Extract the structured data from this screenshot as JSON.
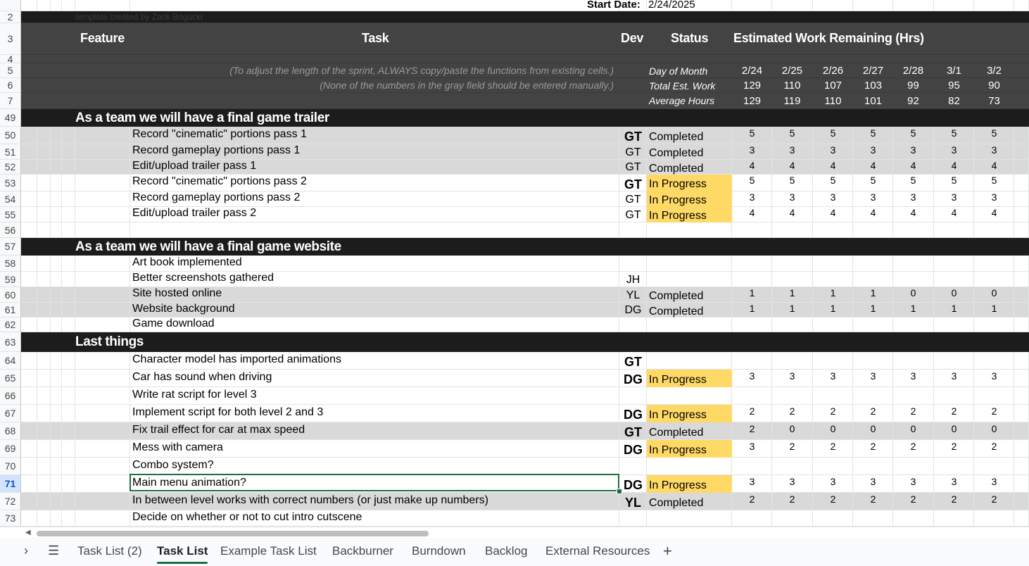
{
  "app": {
    "sheet_tabs_active": "Task List"
  },
  "header": {
    "start_label": "Start Date:",
    "start_value": "2/24/2025",
    "credit": "template created by Zack Bogucki",
    "col_feature": "Feature",
    "col_task": "Task",
    "col_dev": "Dev",
    "col_status": "Status",
    "col_estimate": "Estimated Work Remaining (Hrs)",
    "note1": "(To adjust the length of the sprint, ALWAYS copy/paste the functions from existing cells.)",
    "note2": "(None of the numbers in the gray field should be entered manually.)",
    "lbl_day": "Day of Month",
    "lbl_total": "Total Est. Work",
    "lbl_avg": "Average Hours",
    "dates": [
      "2/24",
      "2/25",
      "2/26",
      "2/27",
      "2/28",
      "3/1",
      "3/2"
    ],
    "totals": [
      "129",
      "110",
      "107",
      "103",
      "99",
      "95",
      "90"
    ],
    "averages": [
      "129",
      "119",
      "110",
      "101",
      "92",
      "82",
      "73"
    ]
  },
  "rows": [
    {
      "n": "49",
      "type": "section",
      "title": "As a team we will have a final game trailer"
    },
    {
      "n": "50",
      "type": "task",
      "bg": "gray",
      "task": "Record \"cinematic\" portions pass 1",
      "dev": "GT",
      "devBold": true,
      "status": "Completed",
      "vals": [
        "5",
        "5",
        "5",
        "5",
        "5",
        "5",
        "5"
      ]
    },
    {
      "n": "51",
      "type": "task",
      "bg": "gray",
      "task": "Record gameplay portions pass 1",
      "dev": "GT",
      "devBold": false,
      "status": "Completed",
      "vals": [
        "3",
        "3",
        "3",
        "3",
        "3",
        "3",
        "3"
      ]
    },
    {
      "n": "52",
      "type": "task",
      "bg": "gray",
      "task": "Edit/upload trailer pass 1",
      "dev": "GT",
      "devBold": false,
      "status": "Completed",
      "vals": [
        "4",
        "4",
        "4",
        "4",
        "4",
        "4",
        "4"
      ]
    },
    {
      "n": "53",
      "type": "task",
      "bg": "white",
      "task": "Record \"cinematic\" portions pass 2",
      "dev": "GT",
      "devBold": true,
      "status": "In Progress",
      "vals": [
        "5",
        "5",
        "5",
        "5",
        "5",
        "5",
        "5"
      ]
    },
    {
      "n": "54",
      "type": "task",
      "bg": "white",
      "task": "Record gameplay portions pass 2",
      "dev": "GT",
      "devBold": false,
      "status": "In Progress",
      "vals": [
        "3",
        "3",
        "3",
        "3",
        "3",
        "3",
        "3"
      ]
    },
    {
      "n": "55",
      "type": "task",
      "bg": "white",
      "task": "Edit/upload trailer pass 2",
      "dev": "GT",
      "devBold": false,
      "status": "In Progress",
      "vals": [
        "4",
        "4",
        "4",
        "4",
        "4",
        "4",
        "4"
      ]
    },
    {
      "n": "56",
      "type": "blank"
    },
    {
      "n": "57",
      "type": "section",
      "title": "As a team we will have a final game website"
    },
    {
      "n": "58",
      "type": "task",
      "bg": "white",
      "task": "Art book implemented",
      "dev": "",
      "devBold": false,
      "status": "",
      "vals": []
    },
    {
      "n": "59",
      "type": "task",
      "bg": "white",
      "task": "Better screenshots gathered",
      "dev": "JH",
      "devBold": false,
      "status": "",
      "vals": []
    },
    {
      "n": "60",
      "type": "task",
      "bg": "gray",
      "task": "Site hosted online",
      "dev": "YL",
      "devBold": false,
      "status": "Completed",
      "vals": [
        "1",
        "1",
        "1",
        "1",
        "0",
        "0",
        "0"
      ]
    },
    {
      "n": "61",
      "type": "task",
      "bg": "gray",
      "task": "Website background",
      "dev": "DG",
      "devBold": false,
      "status": "Completed",
      "vals": [
        "1",
        "1",
        "1",
        "1",
        "1",
        "1",
        "1"
      ]
    },
    {
      "n": "62",
      "type": "task",
      "bg": "white",
      "task": "Game download",
      "dev": "",
      "devBold": false,
      "status": "",
      "vals": []
    },
    {
      "n": "63",
      "type": "section",
      "title": "Last things"
    },
    {
      "n": "64",
      "type": "task",
      "bg": "white",
      "task": "Character model has imported animations",
      "dev": "GT",
      "devBold": true,
      "status": "",
      "vals": []
    },
    {
      "n": "65",
      "type": "task",
      "bg": "white",
      "task": "Car has sound when driving",
      "dev": "DG",
      "devBold": true,
      "status": "In Progress",
      "vals": [
        "3",
        "3",
        "3",
        "3",
        "3",
        "3",
        "3"
      ]
    },
    {
      "n": "66",
      "type": "task",
      "bg": "white",
      "task": "Write rat script for level 3",
      "dev": "",
      "devBold": false,
      "status": "",
      "vals": []
    },
    {
      "n": "67",
      "type": "task",
      "bg": "white",
      "task": "Implement script for both level 2 and 3",
      "dev": "DG",
      "devBold": true,
      "status": "In Progress",
      "vals": [
        "2",
        "2",
        "2",
        "2",
        "2",
        "2",
        "2"
      ]
    },
    {
      "n": "68",
      "type": "task",
      "bg": "gray",
      "task": "Fix trail effect for car at max speed",
      "dev": "GT",
      "devBold": true,
      "status": "Completed",
      "vals": [
        "2",
        "0",
        "0",
        "0",
        "0",
        "0",
        "0"
      ]
    },
    {
      "n": "69",
      "type": "task",
      "bg": "white",
      "task": "Mess with camera",
      "dev": "DG",
      "devBold": true,
      "status": "In Progress",
      "vals": [
        "3",
        "2",
        "2",
        "2",
        "2",
        "2",
        "2"
      ]
    },
    {
      "n": "70",
      "type": "task",
      "bg": "white",
      "task": "Combo system?",
      "dev": "",
      "devBold": false,
      "status": "",
      "vals": []
    },
    {
      "n": "71",
      "type": "task",
      "bg": "white",
      "task": "Main menu animation?",
      "dev": "DG",
      "devBold": true,
      "status": "In Progress",
      "vals": [
        "3",
        "3",
        "3",
        "3",
        "3",
        "3",
        "3"
      ],
      "selected": true
    },
    {
      "n": "72",
      "type": "task",
      "bg": "gray",
      "task": "In between level works with correct numbers (or just make up numbers)",
      "dev": "YL",
      "devBold": true,
      "status": "Completed",
      "vals": [
        "2",
        "2",
        "2",
        "2",
        "2",
        "2",
        "2"
      ]
    },
    {
      "n": "73",
      "type": "task",
      "bg": "white",
      "task": "Decide on whether or not to cut intro cutscene",
      "dev": "",
      "devBold": false,
      "status": "",
      "vals": []
    }
  ],
  "tabs": [
    "Task List (2)",
    "Task List",
    "Example Task List",
    "Backburner",
    "Burndown",
    "Backlog",
    "External Resources"
  ],
  "colors": {
    "section_bg": "#1c1c1c",
    "header_bg": "#434343",
    "gray_row": "#d9d9d9",
    "in_progress": "#ffd966",
    "grid": "#e2e3e3"
  }
}
